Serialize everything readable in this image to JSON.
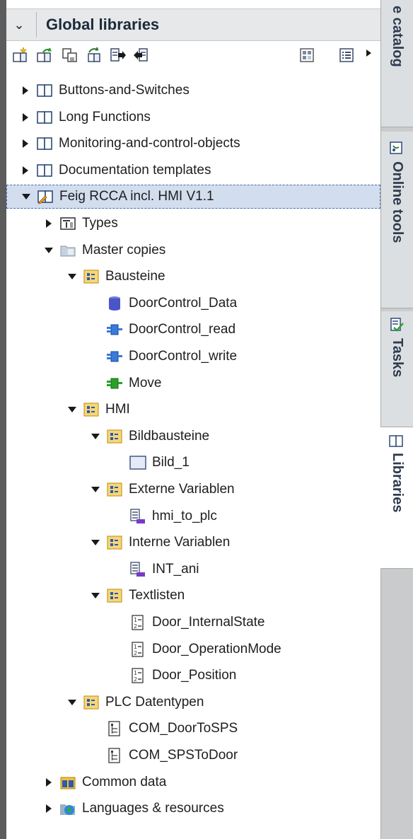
{
  "header": {
    "title": "Global libraries",
    "collapse_icon": "chevron-down-icon"
  },
  "toolbar": {
    "icons": [
      "new-library-icon",
      "open-library-icon",
      "save-library-icon",
      "close-library-icon",
      "update-types-icon",
      "export-icon",
      "library-view-icon",
      "list-view-icon"
    ]
  },
  "tree": [
    {
      "label": "Buttons-and-Switches",
      "icon": "library-book-icon",
      "state": "collapsed"
    },
    {
      "label": "Long Functions",
      "icon": "library-book-icon",
      "state": "collapsed"
    },
    {
      "label": "Monitoring-and-control-objects",
      "icon": "library-book-icon",
      "state": "collapsed"
    },
    {
      "label": "Documentation templates",
      "icon": "library-book-icon",
      "state": "collapsed"
    },
    {
      "label": "Feig RCCA incl. HMI V1.1",
      "icon": "library-open-edit-icon",
      "state": "expanded",
      "selected": true
    },
    {
      "label": "Types",
      "icon": "types-folder-icon",
      "state": "collapsed"
    },
    {
      "label": "Master copies",
      "icon": "folder-icon",
      "state": "expanded"
    },
    {
      "label": "Bausteine",
      "icon": "group-folder-icon",
      "state": "expanded"
    },
    {
      "label": "DoorControl_Data",
      "icon": "data-block-icon",
      "state": "leaf"
    },
    {
      "label": "DoorControl_read",
      "icon": "function-block-icon",
      "state": "leaf"
    },
    {
      "label": "DoorControl_write",
      "icon": "function-block-icon",
      "state": "leaf"
    },
    {
      "label": "Move",
      "icon": "function-icon",
      "state": "leaf"
    },
    {
      "label": "HMI",
      "icon": "group-folder-icon",
      "state": "expanded"
    },
    {
      "label": "Bildbausteine",
      "icon": "group-folder-icon",
      "state": "expanded"
    },
    {
      "label": "Bild_1",
      "icon": "screen-icon",
      "state": "leaf"
    },
    {
      "label": "Externe Variablen",
      "icon": "group-folder-icon",
      "state": "expanded"
    },
    {
      "label": "hmi_to_plc",
      "icon": "tag-table-icon",
      "state": "leaf"
    },
    {
      "label": "Interne Variablen",
      "icon": "group-folder-icon",
      "state": "expanded"
    },
    {
      "label": "INT_ani",
      "icon": "tag-table-icon",
      "state": "leaf"
    },
    {
      "label": "Textlisten",
      "icon": "group-folder-icon",
      "state": "expanded"
    },
    {
      "label": "Door_InternalState",
      "icon": "text-list-icon",
      "state": "leaf"
    },
    {
      "label": "Door_OperationMode",
      "icon": "text-list-icon",
      "state": "leaf"
    },
    {
      "label": "Door_Position",
      "icon": "text-list-icon",
      "state": "leaf"
    },
    {
      "label": "PLC Datentypen",
      "icon": "group-folder-icon",
      "state": "expanded"
    },
    {
      "label": "COM_DoorToSPS",
      "icon": "plc-data-type-icon",
      "state": "leaf"
    },
    {
      "label": "COM_SPSToDoor",
      "icon": "plc-data-type-icon",
      "state": "leaf"
    },
    {
      "label": "Common data",
      "icon": "common-data-icon",
      "state": "collapsed"
    },
    {
      "label": "Languages & resources",
      "icon": "globe-folder-icon",
      "state": "collapsed"
    }
  ],
  "side_tabs": [
    {
      "label": "e catalog",
      "icon": "catalog-icon"
    },
    {
      "label": "Online tools",
      "icon": "online-tools-icon"
    },
    {
      "label": "Tasks",
      "icon": "tasks-icon"
    },
    {
      "label": "Libraries",
      "icon": "library-book-icon",
      "active": true
    }
  ]
}
